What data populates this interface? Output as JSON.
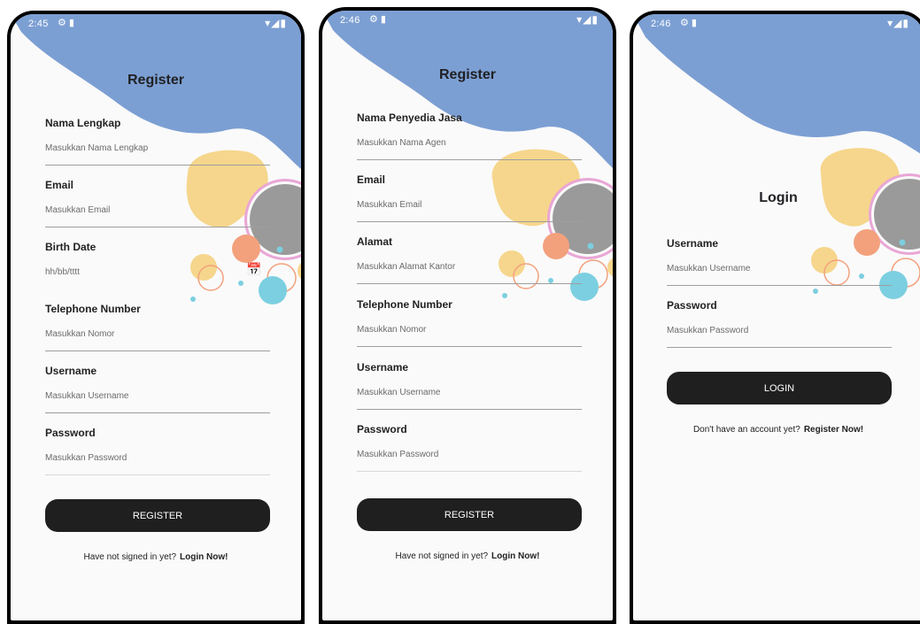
{
  "colors": {
    "accent_blue": "#7c9fd3",
    "blob_yellow": "#f6d68c",
    "gray_circle": "#9a9a9a",
    "pink_ring": "#e9a6d5",
    "orange": "#f3a17d",
    "cyan": "#7ccfe0",
    "button": "#1f1f1f"
  },
  "icons": {
    "statusbar": "settings-sdcard",
    "network": "wifi-signal-battery",
    "date_picker": "calendar-edit-icon"
  },
  "phones": [
    {
      "status_time": "2:45",
      "title": "Register",
      "fields": [
        {
          "label": "Nama Lengkap",
          "placeholder": "Masukkan Nama Lengkap"
        },
        {
          "label": "Email",
          "placeholder": "Masukkan Email"
        },
        {
          "label": "Birth Date",
          "placeholder": "hh/bb/tttt"
        },
        {
          "label": "Telephone Number",
          "placeholder": "Masukkan Nomor"
        },
        {
          "label": "Username",
          "placeholder": "Masukkan Username"
        },
        {
          "label": "Password",
          "placeholder": "Masukkan Password"
        }
      ],
      "button_label": "REGISTER",
      "footer_text": "Have not signed in yet?",
      "footer_link": "Login Now!"
    },
    {
      "status_time": "2:46",
      "title": "Register",
      "fields": [
        {
          "label": "Nama Penyedia Jasa",
          "placeholder": "Masukkan Nama Agen"
        },
        {
          "label": "Email",
          "placeholder": "Masukkan Email"
        },
        {
          "label": "Alamat",
          "placeholder": "Masukkan Alamat Kantor"
        },
        {
          "label": "Telephone Number",
          "placeholder": "Masukkan Nomor"
        },
        {
          "label": "Username",
          "placeholder": "Masukkan Username"
        },
        {
          "label": "Password",
          "placeholder": "Masukkan Password"
        }
      ],
      "button_label": "REGISTER",
      "footer_text": "Have not signed in yet?",
      "footer_link": "Login Now!"
    },
    {
      "status_time": "2:46",
      "title": "Login",
      "fields": [
        {
          "label": "Username",
          "placeholder": "Masukkan Username"
        },
        {
          "label": "Password",
          "placeholder": "Masukkan Password"
        }
      ],
      "button_label": "LOGIN",
      "footer_text": "Don't have an account yet?",
      "footer_link": "Register Now!"
    }
  ]
}
